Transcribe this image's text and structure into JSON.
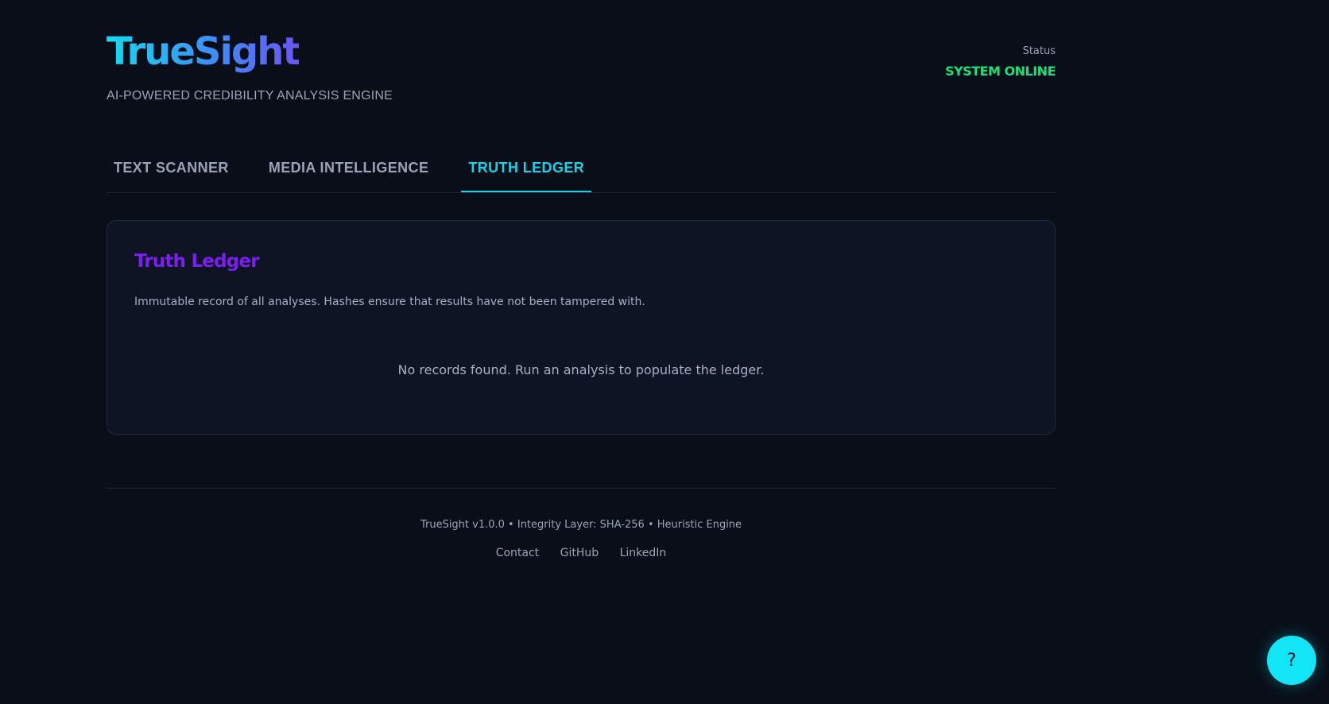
{
  "header": {
    "brand": "TrueSight",
    "tagline": "AI-POWERED CREDIBILITY ANALYSIS ENGINE",
    "status_label": "Status",
    "status_value": "SYSTEM ONLINE"
  },
  "tabs": [
    {
      "label": "TEXT SCANNER",
      "active": false
    },
    {
      "label": "MEDIA INTELLIGENCE",
      "active": false
    },
    {
      "label": "TRUTH LEDGER",
      "active": true
    }
  ],
  "ledger": {
    "title": "Truth Ledger",
    "description": "Immutable record of all analyses. Hashes ensure that results have not been tampered with.",
    "empty_message": "No records found. Run an analysis to populate the ledger."
  },
  "footer": {
    "meta": "TrueSight v1.0.0 • Integrity Layer: SHA-256 • Heuristic Engine",
    "links": [
      "Contact",
      "GitHub",
      "LinkedIn"
    ]
  },
  "help": {
    "label": "?",
    "icon": "question-mark-icon"
  },
  "colors": {
    "background": "#090e18",
    "card": "#0f1424",
    "accent_cyan": "#14d4ea",
    "status_green": "#18e07a",
    "ledger_purple": "#7a1ff0"
  }
}
